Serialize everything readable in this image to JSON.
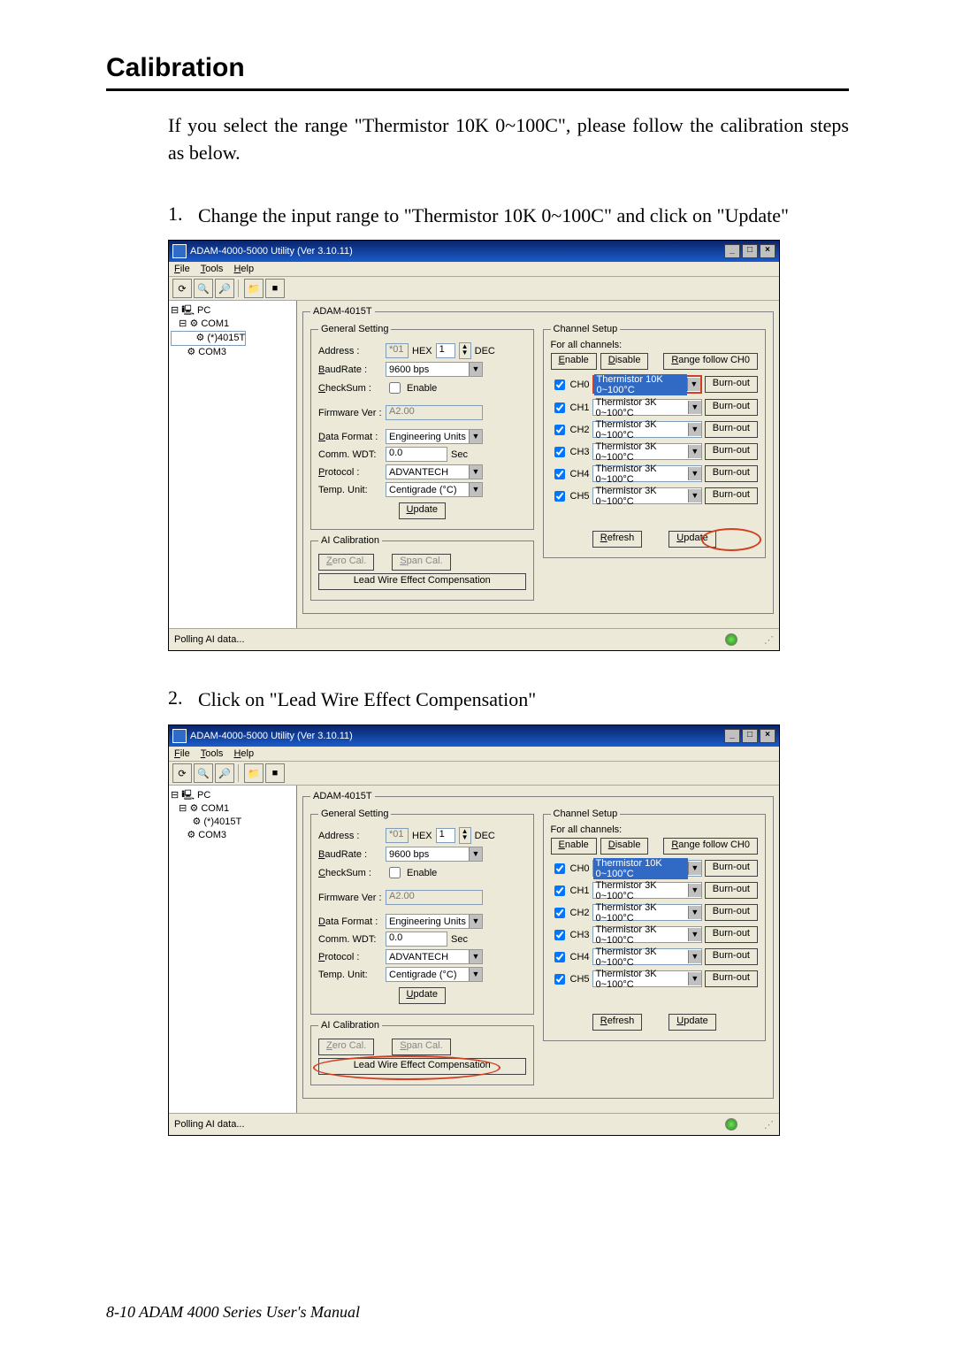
{
  "header": {
    "title": "Calibration"
  },
  "intro": "If you select the range \"Thermistor 10K 0~100C\", please follow the calibration steps as below.",
  "steps": [
    {
      "num": "1.",
      "text": "Change the input range to \"Thermistor 10K 0~100C\" and click on \"Update\""
    },
    {
      "num": "2.",
      "text": "Click on \"Lead Wire Effect Compensation\""
    }
  ],
  "app": {
    "title": "ADAM-4000-5000 Utility (Ver 3.10.11)",
    "menu": {
      "file": "File",
      "tools": "Tools",
      "help": "Help"
    },
    "tree": {
      "pc": "PC",
      "com1": "COM1",
      "device": "(*)4015T",
      "com3": "COM3"
    },
    "panel": {
      "title": "ADAM-4015T",
      "general_legend": "General Setting",
      "address_lbl": "Address :",
      "address_hex": "*01",
      "hex_lbl": "HEX",
      "address_dec": "1",
      "dec_lbl": "DEC",
      "baud_lbl": "BaudRate :",
      "baud_val": "9600 bps",
      "checksum_lbl": "CheckSum :",
      "checksum_chk": "Enable",
      "fw_lbl": "Firmware Ver :",
      "fw_val": "A2.00",
      "df_lbl": "Data Format :",
      "df_val": "Engineering Units",
      "wdt_lbl": "Comm. WDT:",
      "wdt_val": "0.0",
      "wdt_unit": "Sec",
      "proto_lbl": "Protocol :",
      "proto_val": "ADVANTECH",
      "temp_lbl": "Temp. Unit:",
      "temp_val": "Centigrade (°C)",
      "update_btn": "Update",
      "ai_legend": "AI Calibration",
      "zero_btn": "Zero Cal.",
      "span_btn": "Span Cal.",
      "lead_btn": "Lead Wire Effect Compensation",
      "chan_legend": "Channel Setup",
      "chan_hdr": "For all channels:",
      "enable_btn": "Enable",
      "disable_btn": "Disable",
      "range_btn": "Range follow CH0",
      "burnout_btn": "Burn-out",
      "refresh_btn": "Refresh",
      "update2_btn": "Update",
      "channels": [
        {
          "lbl": "CH0",
          "val": "Thermistor 10K 0~100°C",
          "hl": true
        },
        {
          "lbl": "CH1",
          "val": "Thermistor 3K 0~100°C",
          "hl": false
        },
        {
          "lbl": "CH2",
          "val": "Thermistor 3K 0~100°C",
          "hl": false
        },
        {
          "lbl": "CH3",
          "val": "Thermistor 3K 0~100°C",
          "hl": false
        },
        {
          "lbl": "CH4",
          "val": "Thermistor 3K 0~100°C",
          "hl": false
        },
        {
          "lbl": "CH5",
          "val": "Thermistor 3K 0~100°C",
          "hl": false
        }
      ]
    },
    "status": "Polling AI data..."
  },
  "footer": "8-10 ADAM 4000 Series User's Manual"
}
